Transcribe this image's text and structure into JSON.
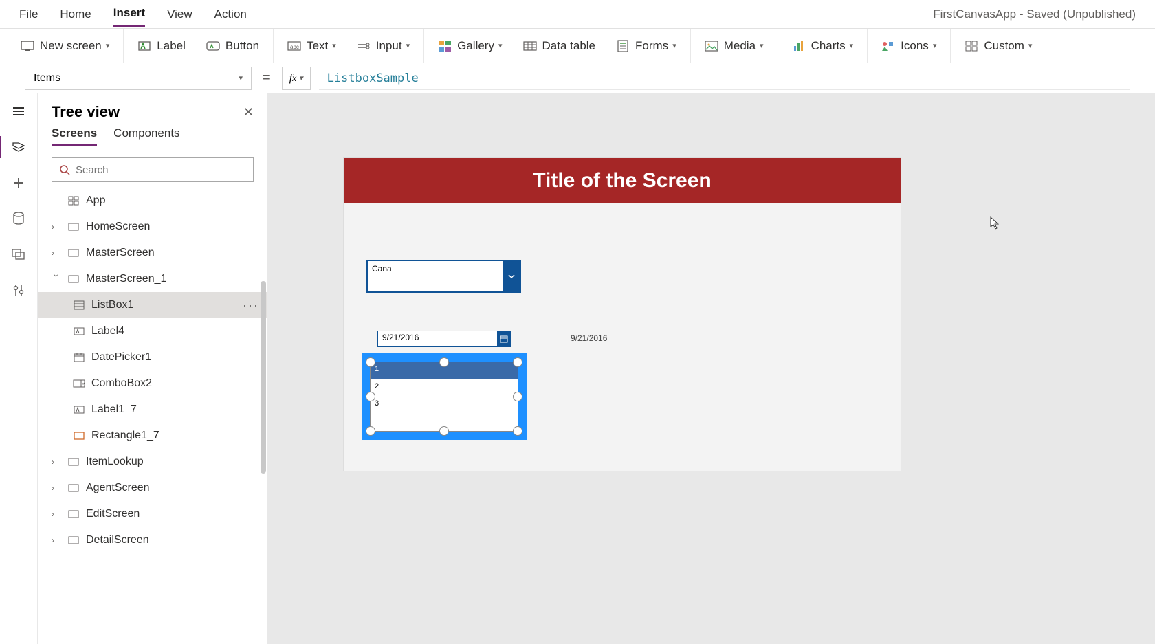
{
  "app_title": "FirstCanvasApp - Saved (Unpublished)",
  "menu": {
    "file": "File",
    "home": "Home",
    "insert": "Insert",
    "view": "View",
    "action": "Action"
  },
  "ribbon": {
    "new_screen": "New screen",
    "label": "Label",
    "button": "Button",
    "text": "Text",
    "input": "Input",
    "gallery": "Gallery",
    "data_table": "Data table",
    "forms": "Forms",
    "media": "Media",
    "charts": "Charts",
    "icons": "Icons",
    "custom": "Custom"
  },
  "formula": {
    "property": "Items",
    "expression": "ListboxSample"
  },
  "tree": {
    "title": "Tree view",
    "tabs": {
      "screens": "Screens",
      "components": "Components"
    },
    "search_placeholder": "Search",
    "nodes": {
      "app": "App",
      "home": "HomeScreen",
      "master": "MasterScreen",
      "master1": "MasterScreen_1",
      "listbox1": "ListBox1",
      "label4": "Label4",
      "datepicker1": "DatePicker1",
      "combobox2": "ComboBox2",
      "label1_7": "Label1_7",
      "rect1_7": "Rectangle1_7",
      "itemlookup": "ItemLookup",
      "agent": "AgentScreen",
      "edit": "EditScreen",
      "detail": "DetailScreen"
    }
  },
  "canvas": {
    "screen_title": "Title of the Screen",
    "combo_text": "Cana",
    "date_value": "9/21/2016",
    "date_label": "9/21/2016",
    "listbox_items": {
      "i1": "1",
      "i2": "2",
      "i3": "3"
    }
  }
}
